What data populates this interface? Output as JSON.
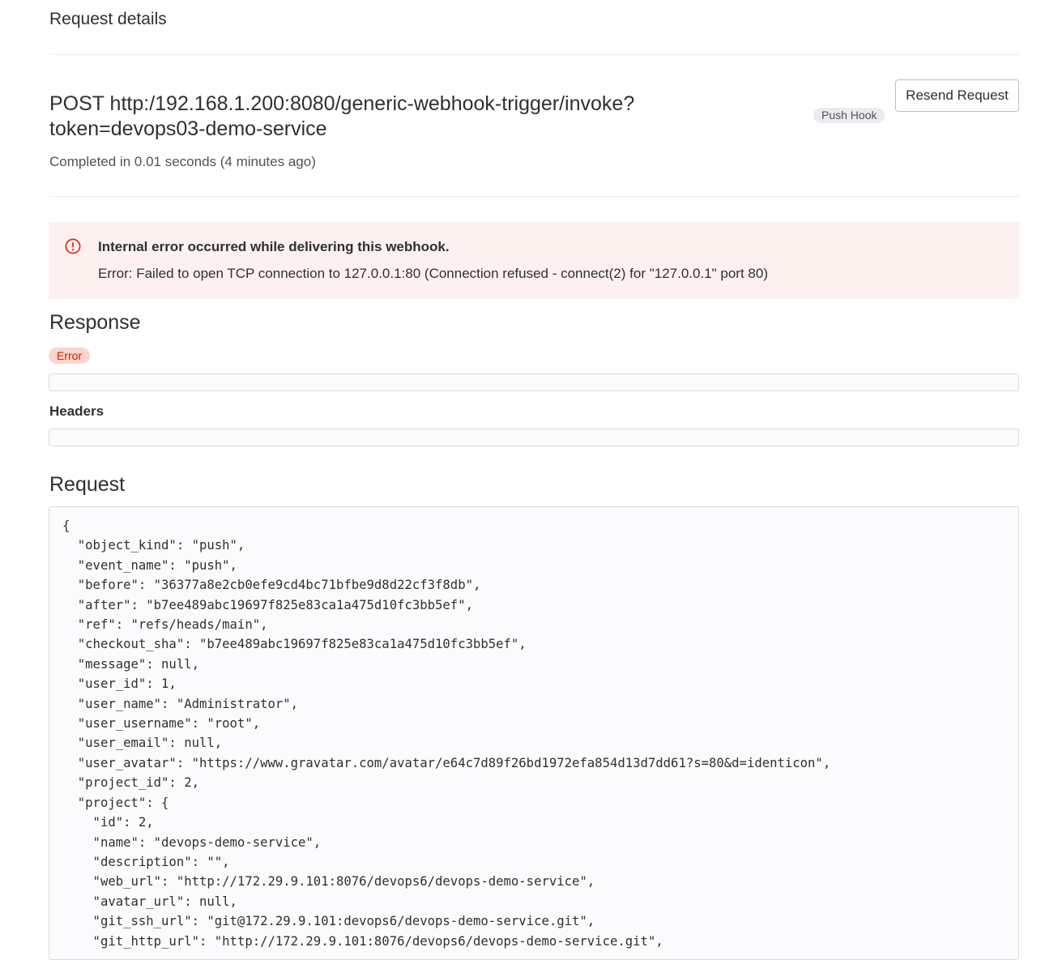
{
  "header": {
    "title": "Request details"
  },
  "request_summary": {
    "method_url": "POST http:/192.168.1.200:8080/generic-webhook-trigger/invoke?token=devops03-demo-service",
    "hook_type": "Push Hook",
    "resend_label": "Resend Request",
    "completed": "Completed in 0.01 seconds (4 minutes ago)"
  },
  "alert": {
    "icon": "error-circle-icon",
    "title": "Internal error occurred while delivering this webhook.",
    "message": "Error: Failed to open TCP connection to 127.0.0.1:80 (Connection refused - connect(2) for \"127.0.0.1\" port 80)",
    "background_color": "#fcf1ef",
    "icon_color": "#dd2b0e"
  },
  "response": {
    "title": "Response",
    "status_badge": "Error",
    "body": "",
    "headers_title": "Headers",
    "headers": ""
  },
  "request": {
    "title": "Request",
    "body": "{\n  \"object_kind\": \"push\",\n  \"event_name\": \"push\",\n  \"before\": \"36377a8e2cb0efe9cd4bc71bfbe9d8d22cf3f8db\",\n  \"after\": \"b7ee489abc19697f825e83ca1a475d10fc3bb5ef\",\n  \"ref\": \"refs/heads/main\",\n  \"checkout_sha\": \"b7ee489abc19697f825e83ca1a475d10fc3bb5ef\",\n  \"message\": null,\n  \"user_id\": 1,\n  \"user_name\": \"Administrator\",\n  \"user_username\": \"root\",\n  \"user_email\": null,\n  \"user_avatar\": \"https://www.gravatar.com/avatar/e64c7d89f26bd1972efa854d13d7dd61?s=80&d=identicon\",\n  \"project_id\": 2,\n  \"project\": {\n    \"id\": 2,\n    \"name\": \"devops-demo-service\",\n    \"description\": \"\",\n    \"web_url\": \"http://172.29.9.101:8076/devops6/devops-demo-service\",\n    \"avatar_url\": null,\n    \"git_ssh_url\": \"git@172.29.9.101:devops6/devops-demo-service.git\",\n    \"git_http_url\": \"http://172.29.9.101:8076/devops6/devops-demo-service.git\","
  }
}
